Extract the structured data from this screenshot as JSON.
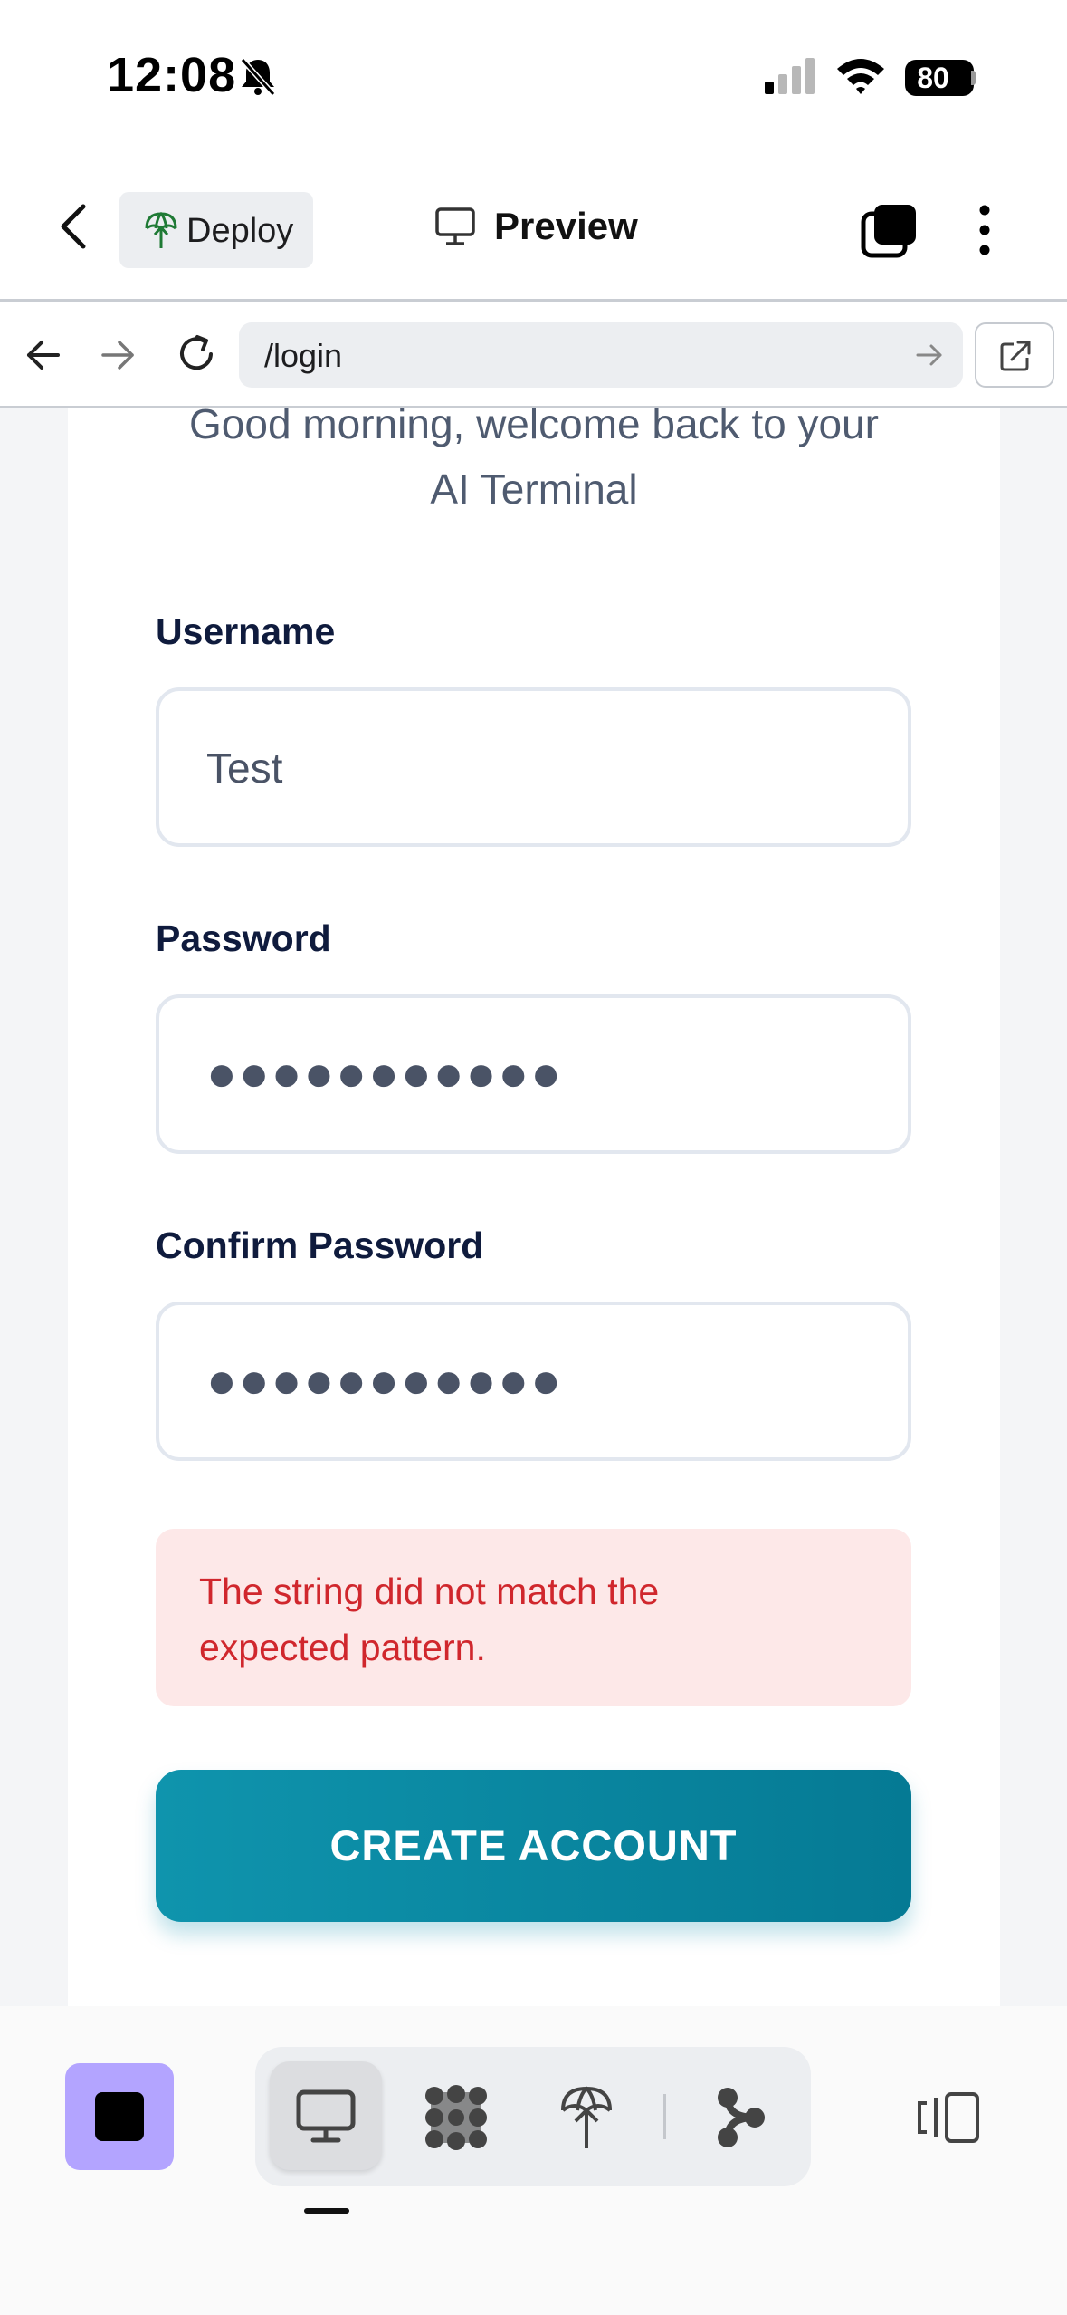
{
  "status_bar": {
    "time": "12:08",
    "battery": "80"
  },
  "header": {
    "deploy_label": "Deploy",
    "preview_label": "Preview"
  },
  "url_bar": {
    "url": "/login"
  },
  "form": {
    "subtitle": "Good morning, welcome back to your AI Terminal",
    "username_label": "Username",
    "username_value": "Test",
    "password_label": "Password",
    "password_dots": "●●●●●●●●●●●",
    "confirm_label": "Confirm Password",
    "confirm_dots": "●●●●●●●●●●●",
    "error_message": "The string did not match the expected pattern.",
    "submit_label": "CREATE ACCOUNT"
  },
  "colors": {
    "accent": "#0b8aa3",
    "error_bg": "#fde8e8",
    "error_text": "#d0272d",
    "stop_button": "#b3a4ff"
  },
  "icons": [
    "bell-slash-icon",
    "signal-icon",
    "wifi-icon",
    "battery-icon",
    "chevron-left-icon",
    "deploy-icon",
    "monitor-icon",
    "tabs-icon",
    "more-vertical-icon",
    "arrow-left-icon",
    "arrow-right-icon",
    "reload-icon",
    "go-arrow-icon",
    "external-link-icon",
    "stop-icon",
    "preview-tool-icon",
    "workspace-tool-icon",
    "deploy-tool-icon",
    "git-tool-icon",
    "panel-toggle-icon"
  ]
}
